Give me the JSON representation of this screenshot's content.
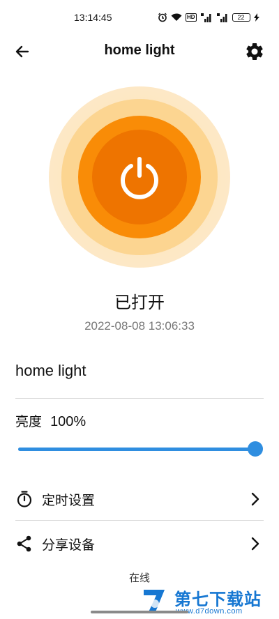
{
  "status_bar": {
    "time": "13:14:45",
    "battery_level": "22",
    "hd_label": "HD",
    "icons": [
      "alarm-icon",
      "wifi-icon",
      "hd-icon",
      "signal-5g-icon",
      "signal-4g-icon",
      "battery-icon",
      "charging-icon"
    ]
  },
  "toolbar": {
    "title": "home light",
    "icons": [
      "back-arrow-icon",
      "gear-icon"
    ]
  },
  "power": {
    "state": "已打开",
    "updated_at": "2022-08-08 13:06:33",
    "is_on": true,
    "colors": {
      "outer": "#fde3b6",
      "mid": "#fcd591",
      "inner": "#f98c07",
      "core": "#ee7400"
    }
  },
  "device": {
    "name": "home light"
  },
  "brightness": {
    "label": "亮度",
    "value_text": "100%",
    "value": 100,
    "accent": "#2f8ee0"
  },
  "rows": [
    {
      "label": "定时设置",
      "icon": "timer-icon"
    },
    {
      "label": "分享设备",
      "icon": "share-icon"
    }
  ],
  "footer": {
    "status": "在线"
  },
  "watermark": {
    "title": "第七下载站",
    "url": "www.d7down.com"
  }
}
